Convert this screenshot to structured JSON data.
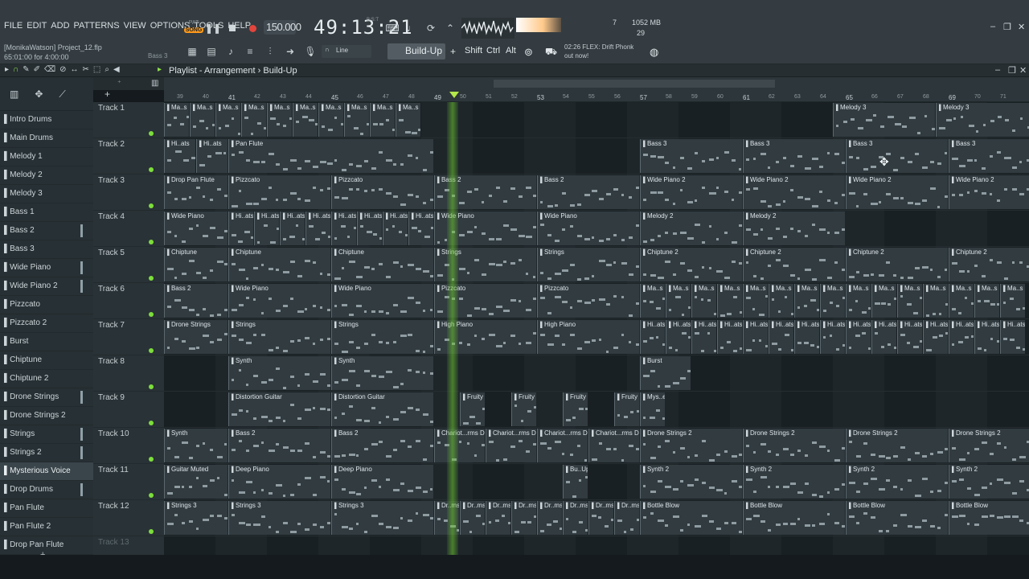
{
  "menu": [
    "FILE",
    "EDIT",
    "ADD",
    "PATTERNS",
    "VIEW",
    "OPTIONS",
    "TOOLS",
    "HELP"
  ],
  "project": {
    "user_file": "[MonikaWatson] Project_12.flp",
    "position": "65:01:00 for 4:00:00",
    "channel": "Bass 3"
  },
  "transport": {
    "pat_label": "PAT",
    "song_label": "SONG",
    "bpm": "150.000",
    "time": "49:13:21",
    "time_unit": "B:S:T"
  },
  "monitor": {
    "cpu_value": "7",
    "memory": "1052 MB",
    "polyphony": "29"
  },
  "toolbar": {
    "snap": "Line",
    "pattern": "Build-Up",
    "shift": "Shift",
    "ctrl": "Ctrl",
    "alt": "Alt"
  },
  "hint": {
    "line1": "02:26  FLEX: Drift Phonk",
    "line2": "out now!"
  },
  "playlist": {
    "title": "Playlist - Arrangement",
    "sep": "›",
    "pattern": "Build-Up"
  },
  "patterns": [
    {
      "label": "Intro Drums"
    },
    {
      "label": "Main Drums"
    },
    {
      "label": "Melody 1"
    },
    {
      "label": "Melody 2"
    },
    {
      "label": "Melody 3"
    },
    {
      "label": "Bass 1"
    },
    {
      "label": "Bass 2"
    },
    {
      "label": "Bass 3"
    },
    {
      "label": "Wide Piano"
    },
    {
      "label": "Wide Piano 2"
    },
    {
      "label": "Pizzcato"
    },
    {
      "label": "Pizzcato 2"
    },
    {
      "label": "Burst"
    },
    {
      "label": "Chiptune"
    },
    {
      "label": "Chiptune 2"
    },
    {
      "label": "Drone Strings"
    },
    {
      "label": "Drone Strings 2"
    },
    {
      "label": "Strings"
    },
    {
      "label": "Strings 2"
    },
    {
      "label": "Mysterious Voice"
    },
    {
      "label": "Drop Drums"
    },
    {
      "label": "Pan Flute"
    },
    {
      "label": "Pan Flute 2"
    },
    {
      "label": "Drop Pan Flute"
    }
  ],
  "tracks": [
    {
      "name": "Track 1"
    },
    {
      "name": "Track 2"
    },
    {
      "name": "Track 3"
    },
    {
      "name": "Track 4"
    },
    {
      "name": "Track 5"
    },
    {
      "name": "Track 6"
    },
    {
      "name": "Track 7"
    },
    {
      "name": "Track 8"
    },
    {
      "name": "Track 9"
    },
    {
      "name": "Track 10"
    },
    {
      "name": "Track 11"
    },
    {
      "name": "Track 12"
    },
    {
      "name": "Track 13"
    }
  ],
  "ruler_bars": [
    39,
    40,
    41,
    42,
    43,
    44,
    45,
    46,
    47,
    48,
    49,
    50,
    51,
    52,
    53,
    54,
    55,
    56,
    57,
    58,
    59,
    60,
    61,
    62,
    63,
    64,
    65,
    66,
    67,
    68,
    69,
    70,
    71
  ],
  "clips": [
    {
      "t": 0,
      "c": [
        [
          "Ma..s",
          0,
          1
        ],
        [
          "Ma..s",
          1,
          2
        ],
        [
          "Ma..s",
          2,
          3
        ],
        [
          "Ma..s",
          3,
          4
        ],
        [
          "Ma..s",
          4,
          5
        ],
        [
          "Ma..s",
          5,
          6
        ],
        [
          "Ma..s",
          6,
          7
        ],
        [
          "Ma..s",
          7,
          8
        ],
        [
          "Ma..s",
          8,
          9
        ],
        [
          "Ma..s",
          9,
          10
        ],
        [
          "Melody 3",
          26,
          30
        ],
        [
          "Melody 3",
          30,
          34
        ]
      ]
    },
    {
      "t": 1,
      "c": [
        [
          "Hi..ats",
          0,
          1.25
        ],
        [
          "Hi..ats",
          1.25,
          2.5
        ],
        [
          "Pan Flute",
          2.5,
          10.5
        ],
        [
          "Bass 3",
          18.5,
          22.5
        ],
        [
          "Bass 3",
          22.5,
          26.5
        ],
        [
          "Bass 3",
          26.5,
          30.5
        ],
        [
          "Bass 3",
          30.5,
          34
        ]
      ]
    },
    {
      "t": 2,
      "c": [
        [
          "Drop Pan Flute",
          0,
          2.5
        ],
        [
          "Pizzcato",
          2.5,
          6.5
        ],
        [
          "Pizzcato",
          6.5,
          10.5
        ],
        [
          "Bass 2",
          10.5,
          14.5
        ],
        [
          "Bass 2",
          14.5,
          18.5
        ],
        [
          "Wide Piano 2",
          18.5,
          22.5
        ],
        [
          "Wide Piano 2",
          22.5,
          26.5
        ],
        [
          "Wide Piano 2",
          26.5,
          30.5
        ],
        [
          "Wide Piano 2",
          30.5,
          34
        ]
      ]
    },
    {
      "t": 3,
      "c": [
        [
          "Wide Piano",
          0,
          2.5
        ],
        [
          "Hi..ats",
          2.5,
          3.5
        ],
        [
          "Hi..ats",
          3.5,
          4.5
        ],
        [
          "Hi..ats",
          4.5,
          5.5
        ],
        [
          "Hi..ats",
          5.5,
          6.5
        ],
        [
          "Hi..ats",
          6.5,
          7.5
        ],
        [
          "Hi..ats",
          7.5,
          8.5
        ],
        [
          "Hi..ats",
          8.5,
          9.5
        ],
        [
          "Hi..ats",
          9.5,
          10.5
        ],
        [
          "Wide Piano",
          10.5,
          14.5
        ],
        [
          "Wide Piano",
          14.5,
          18.5
        ],
        [
          "Melody 2",
          18.5,
          22.5
        ],
        [
          "Melody 2",
          22.5,
          26.5
        ]
      ]
    },
    {
      "t": 4,
      "c": [
        [
          "Chiptune",
          0,
          2.5
        ],
        [
          "Chiptune",
          2.5,
          6.5
        ],
        [
          "Chiptune",
          6.5,
          10.5
        ],
        [
          "Strings",
          10.5,
          14.5
        ],
        [
          "Strings",
          14.5,
          18.5
        ],
        [
          "Chiptune 2",
          18.5,
          22.5
        ],
        [
          "Chiptune 2",
          22.5,
          26.5
        ],
        [
          "Chiptune 2",
          26.5,
          30.5
        ],
        [
          "Chiptune 2",
          30.5,
          34
        ]
      ]
    },
    {
      "t": 5,
      "c": [
        [
          "Bass 2",
          0,
          2.5
        ],
        [
          "Wide Piano",
          2.5,
          6.5
        ],
        [
          "Wide Piano",
          6.5,
          10.5
        ],
        [
          "Pizzcato",
          10.5,
          14.5
        ],
        [
          "Pizzcato",
          14.5,
          18.5
        ],
        [
          "Ma..s",
          18.5,
          19.5
        ],
        [
          "Ma..s",
          19.5,
          20.5
        ],
        [
          "Ma..s",
          20.5,
          21.5
        ],
        [
          "Ma..s",
          21.5,
          22.5
        ],
        [
          "Ma..s",
          22.5,
          23.5
        ],
        [
          "Ma..s",
          23.5,
          24.5
        ],
        [
          "Ma..s",
          24.5,
          25.5
        ],
        [
          "Ma..s",
          25.5,
          26.5
        ],
        [
          "Ma..s",
          26.5,
          27.5
        ],
        [
          "Ma..s",
          27.5,
          28.5
        ],
        [
          "Ma..s",
          28.5,
          29.5
        ],
        [
          "Ma..s",
          29.5,
          30.5
        ],
        [
          "Ma..s",
          30.5,
          31.5
        ],
        [
          "Ma..s",
          31.5,
          32.5
        ],
        [
          "Ma..s",
          32.5,
          33.5
        ]
      ]
    },
    {
      "t": 6,
      "c": [
        [
          "Drone Strings",
          0,
          2.5
        ],
        [
          "Strings",
          2.5,
          6.5
        ],
        [
          "Strings",
          6.5,
          10.5
        ],
        [
          "High Piano",
          10.5,
          14.5
        ],
        [
          "High Piano",
          14.5,
          18.5
        ],
        [
          "Hi..ats",
          18.5,
          19.5
        ],
        [
          "Hi..ats",
          19.5,
          20.5
        ],
        [
          "Hi..ats",
          20.5,
          21.5
        ],
        [
          "Hi..ats",
          21.5,
          22.5
        ],
        [
          "Hi..ats",
          22.5,
          23.5
        ],
        [
          "Hi..ats",
          23.5,
          24.5
        ],
        [
          "Hi..ats",
          24.5,
          25.5
        ],
        [
          "Hi..ats",
          25.5,
          26.5
        ],
        [
          "Hi..ats",
          26.5,
          27.5
        ],
        [
          "Hi..ats",
          27.5,
          28.5
        ],
        [
          "Hi..ats",
          28.5,
          29.5
        ],
        [
          "Hi..ats",
          29.5,
          30.5
        ],
        [
          "Hi..ats",
          30.5,
          31.5
        ],
        [
          "Hi..ats",
          31.5,
          32.5
        ],
        [
          "Hi..ats",
          32.5,
          33.5
        ]
      ]
    },
    {
      "t": 7,
      "c": [
        [
          "Synth",
          2.5,
          6.5
        ],
        [
          "Synth",
          6.5,
          10.5
        ],
        [
          "Burst",
          18.5,
          20.5
        ]
      ]
    },
    {
      "t": 8,
      "c": [
        [
          "Distortion Guitar",
          2.5,
          6.5
        ],
        [
          "Distortion Guitar",
          6.5,
          10.5
        ],
        [
          "Fruity",
          11.5,
          12.5
        ],
        [
          "Fruity",
          13.5,
          14.5
        ],
        [
          "Fruity",
          15.5,
          16.5
        ],
        [
          "Fruity",
          17.5,
          18.5
        ],
        [
          "Mys..e",
          18.5,
          19.5
        ]
      ]
    },
    {
      "t": 9,
      "c": [
        [
          "Synth",
          0,
          2.5
        ],
        [
          "Bass 2",
          2.5,
          6.5
        ],
        [
          "Bass 2",
          6.5,
          10.5
        ],
        [
          "Chariot...rms Drop",
          10.5,
          12.5
        ],
        [
          "Chariot...rms Drop",
          12.5,
          14.5
        ],
        [
          "Chariot...rms Drop",
          14.5,
          16.5
        ],
        [
          "Chariot...rms Drop",
          16.5,
          18.5
        ],
        [
          "Drone Strings 2",
          18.5,
          22.5
        ],
        [
          "Drone Strings 2",
          22.5,
          26.5
        ],
        [
          "Drone Strings 2",
          26.5,
          30.5
        ],
        [
          "Drone Strings 2",
          30.5,
          34
        ]
      ]
    },
    {
      "t": 10,
      "c": [
        [
          "Guitar Muted",
          0,
          2.5
        ],
        [
          "Deep Piano",
          2.5,
          6.5
        ],
        [
          "Deep Piano",
          6.5,
          10.5
        ],
        [
          "Bu..Up",
          15.5,
          16.5
        ],
        [
          "Synth 2",
          18.5,
          22.5
        ],
        [
          "Synth 2",
          22.5,
          26.5
        ],
        [
          "Synth 2",
          26.5,
          30.5
        ],
        [
          "Synth 2",
          30.5,
          34
        ]
      ]
    },
    {
      "t": 11,
      "c": [
        [
          "Strings 3",
          0,
          2.5
        ],
        [
          "Strings 3",
          2.5,
          6.5
        ],
        [
          "Strings 3",
          6.5,
          10.5
        ],
        [
          "Dr..ms",
          10.5,
          11.5
        ],
        [
          "Dr..ms",
          11.5,
          12.5
        ],
        [
          "Dr..ms",
          12.5,
          13.5
        ],
        [
          "Dr..ms",
          13.5,
          14.5
        ],
        [
          "Dr..ms",
          14.5,
          15.5
        ],
        [
          "Dr..ms",
          15.5,
          16.5
        ],
        [
          "Dr..ms",
          16.5,
          17.5
        ],
        [
          "Dr..ms",
          17.5,
          18.5
        ],
        [
          "Bottle Blow",
          18.5,
          22.5
        ],
        [
          "Bottle Blow",
          22.5,
          26.5
        ],
        [
          "Bottle Blow",
          26.5,
          30.5
        ],
        [
          "Bottle Blow",
          30.5,
          34
        ]
      ]
    }
  ],
  "colors": {
    "accent": "#ff9a1a",
    "playhead": "#7cde3a",
    "clip": "#313b40",
    "background": "#1b2226"
  }
}
